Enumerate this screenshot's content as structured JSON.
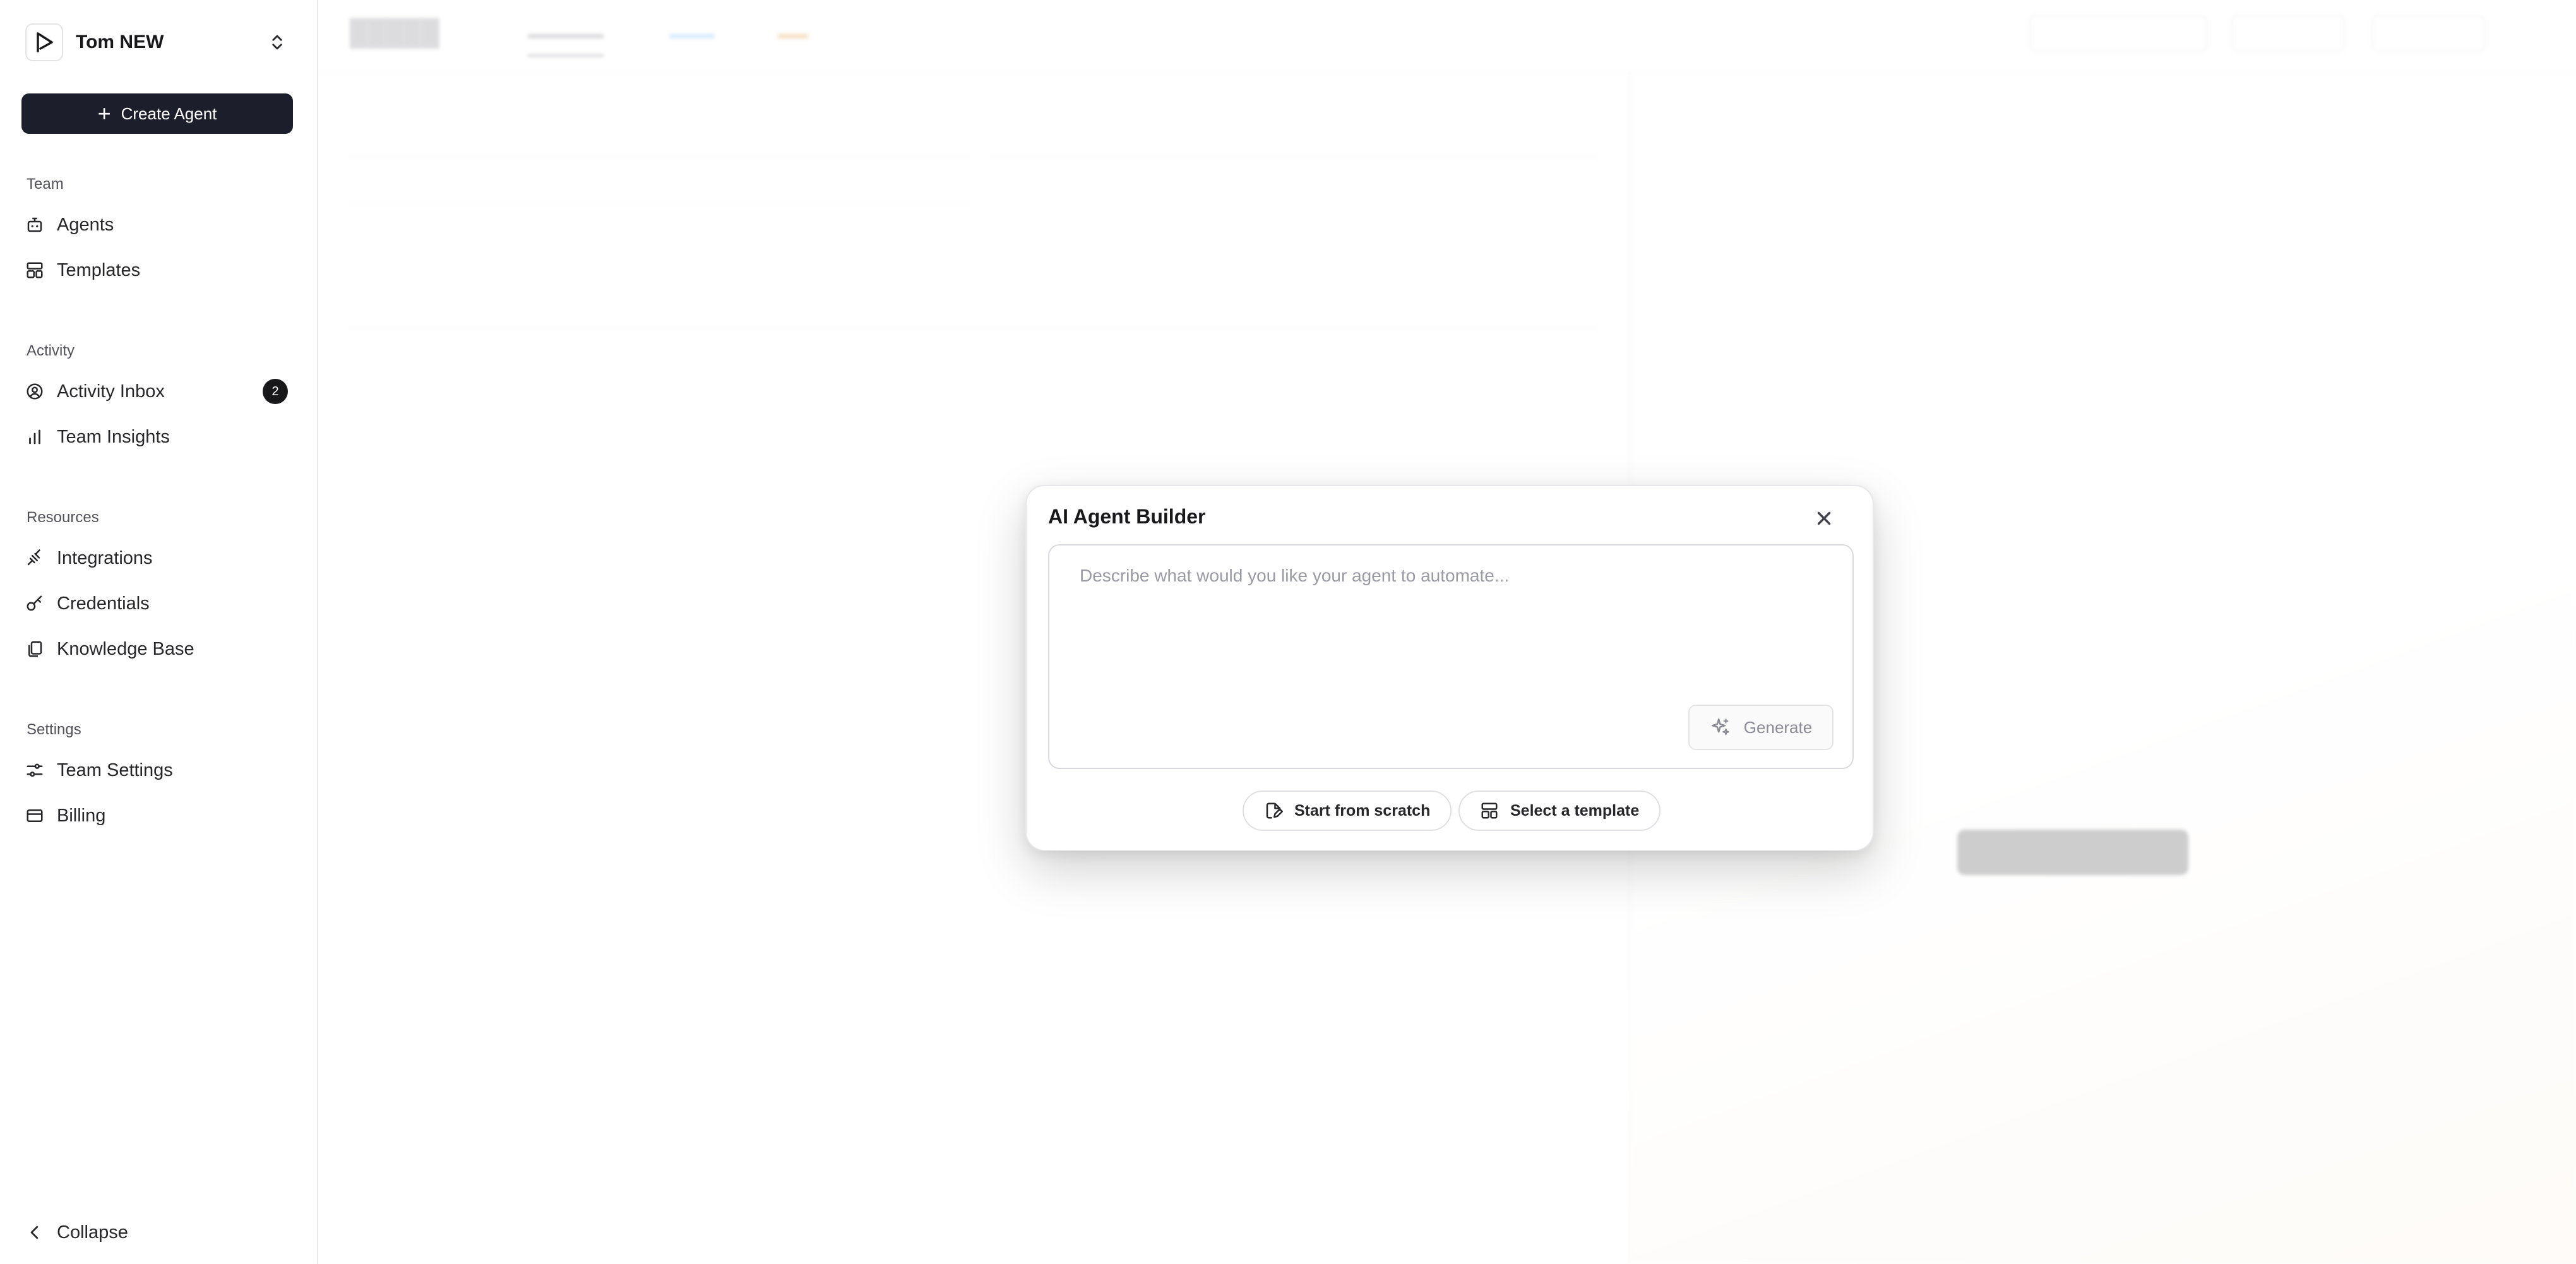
{
  "sidebar": {
    "team_name": "Tom NEW",
    "create_button": "Create Agent",
    "sections": {
      "team": {
        "label": "Team",
        "items": [
          "Agents",
          "Templates"
        ]
      },
      "activity": {
        "label": "Activity",
        "items": [
          "Activity Inbox",
          "Team Insights"
        ],
        "inbox_badge": "2"
      },
      "resources": {
        "label": "Resources",
        "items": [
          "Integrations",
          "Credentials",
          "Knowledge Base"
        ]
      },
      "settings": {
        "label": "Settings",
        "items": [
          "Team Settings",
          "Billing"
        ]
      }
    },
    "collapse": "Collapse"
  },
  "modal": {
    "title": "AI Agent Builder",
    "placeholder": "Describe what would you like your agent to automate...",
    "generate": "Generate",
    "start_from_scratch": "Start from scratch",
    "select_template": "Select a template"
  }
}
